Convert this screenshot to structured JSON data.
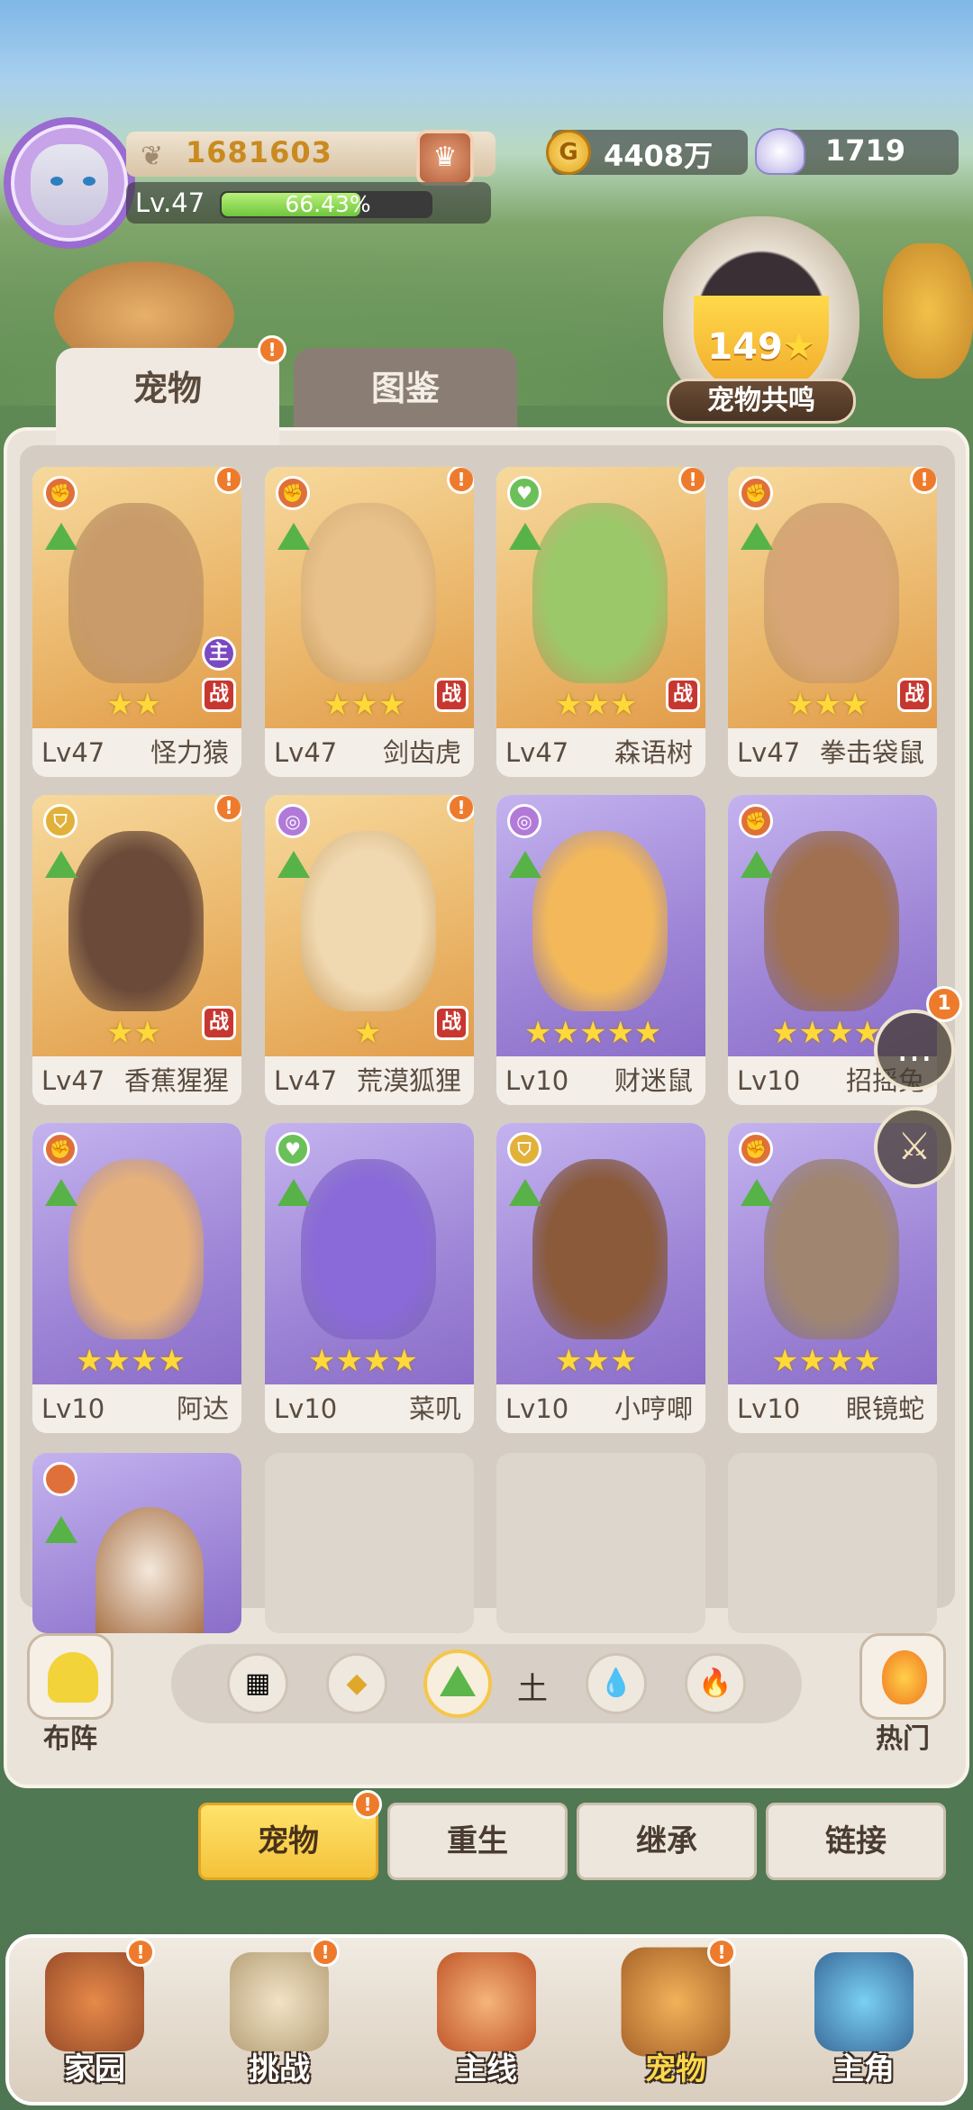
{
  "player": {
    "power": "1681603",
    "level": "Lv.47",
    "xp_percent_text": "66.43%",
    "xp_fraction": 0.6643
  },
  "currency": {
    "gold": "4408万",
    "gems": "1719",
    "gold_glyph": "G"
  },
  "resonance": {
    "count": "149",
    "label": "宠物共鸣"
  },
  "tabs": {
    "pets": "宠物",
    "codex": "图鉴"
  },
  "pets": [
    {
      "lv": "Lv47",
      "name": "怪力猿",
      "stars": "★★",
      "type": "attack",
      "color": "orange",
      "alert": "!",
      "war": "战",
      "main": "主"
    },
    {
      "lv": "Lv47",
      "name": "剑齿虎",
      "stars": "★★★",
      "type": "attack",
      "color": "orange",
      "alert": "!",
      "war": "战"
    },
    {
      "lv": "Lv47",
      "name": "森语树",
      "stars": "★★★",
      "type": "heal",
      "color": "orange",
      "alert": "!",
      "war": "战"
    },
    {
      "lv": "Lv47",
      "name": "拳击袋鼠",
      "stars": "★★★",
      "type": "attack",
      "color": "orange",
      "alert": "!",
      "war": "战"
    },
    {
      "lv": "Lv47",
      "name": "香蕉猩猩",
      "stars": "★★",
      "type": "defense",
      "color": "orange",
      "alert": "!",
      "war": "战"
    },
    {
      "lv": "Lv47",
      "name": "荒漠狐狸",
      "stars": "★",
      "type": "control",
      "color": "orange",
      "alert": "!",
      "war": "战"
    },
    {
      "lv": "Lv10",
      "name": "财迷鼠",
      "stars": "★★★★★",
      "type": "control",
      "color": "purple"
    },
    {
      "lv": "Lv10",
      "name": "招摇兔",
      "stars": "★★★★",
      "type": "attack",
      "color": "purple"
    },
    {
      "lv": "Lv10",
      "name": "阿达",
      "stars": "★★★★",
      "type": "attack",
      "color": "purple"
    },
    {
      "lv": "Lv10",
      "name": "菜叽",
      "stars": "★★★★",
      "type": "heal",
      "color": "purple"
    },
    {
      "lv": "Lv10",
      "name": "小哼唧",
      "stars": "★★★",
      "type": "defense",
      "color": "purple"
    },
    {
      "lv": "Lv10",
      "name": "眼镜蛇",
      "stars": "★★★★",
      "type": "attack",
      "color": "purple"
    }
  ],
  "filters": {
    "lineup": "布阵",
    "element": "土",
    "hot": "热门"
  },
  "chat": {
    "badge": "1"
  },
  "subtabs": {
    "pets": "宠物",
    "rebirth": "重生",
    "inherit": "继承",
    "link": "链接"
  },
  "nav": {
    "home": "家园",
    "challenge": "挑战",
    "main": "主线",
    "pets": "宠物",
    "hero": "主角"
  },
  "colors": {
    "attack": "#e0703a",
    "heal": "#6cc05a",
    "defense": "#e2b13a",
    "control": "#b27ad8"
  }
}
